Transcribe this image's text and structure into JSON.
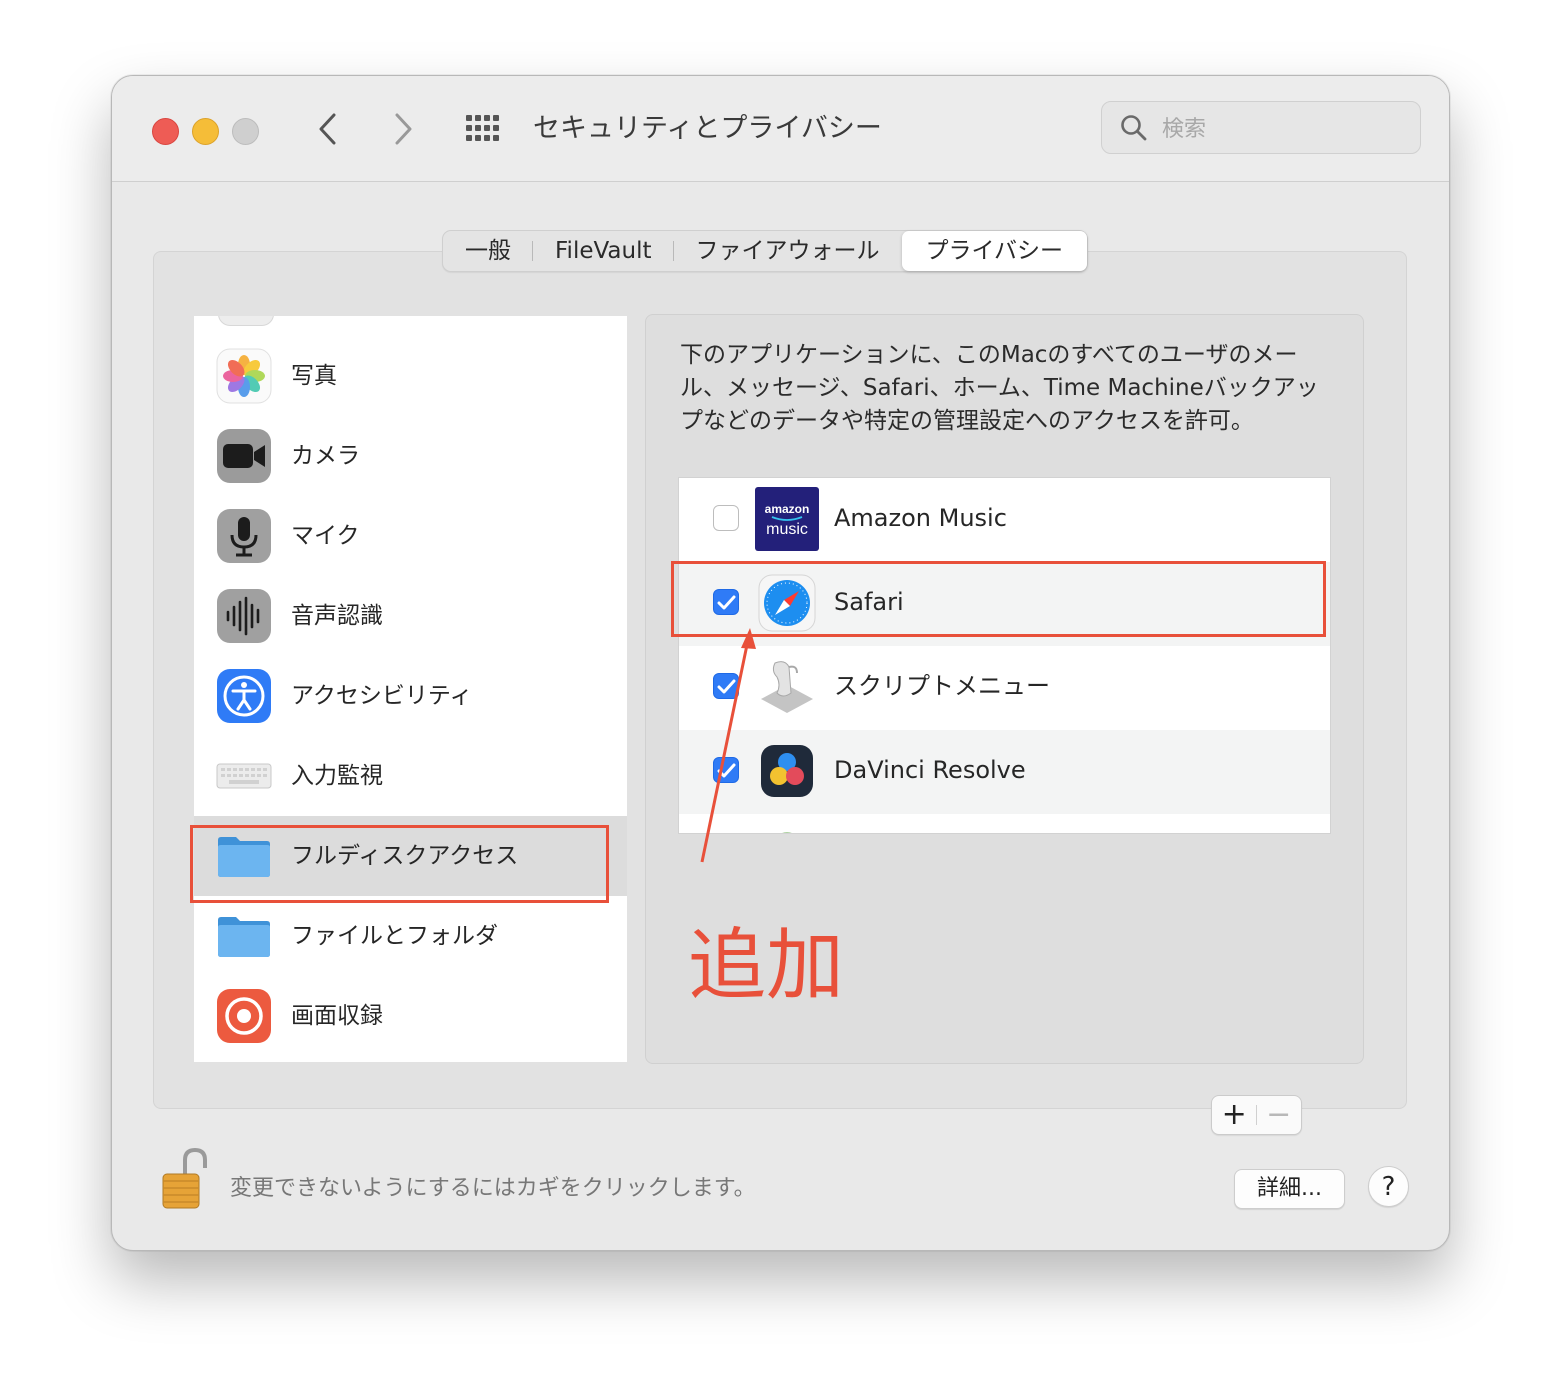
{
  "window": {
    "title": "セキュリティとプライバシー",
    "search_placeholder": "検索"
  },
  "tabs": [
    {
      "label": "一般",
      "active": false
    },
    {
      "label": "FileVault",
      "active": false
    },
    {
      "label": "ファイアウォール",
      "active": false
    },
    {
      "label": "プライバシー",
      "active": true
    }
  ],
  "sidebar": {
    "items": [
      {
        "label": "写真",
        "icon": "photos-icon"
      },
      {
        "label": "カメラ",
        "icon": "camera-icon"
      },
      {
        "label": "マイク",
        "icon": "microphone-icon"
      },
      {
        "label": "音声認識",
        "icon": "speech-recognition-icon"
      },
      {
        "label": "アクセシビリティ",
        "icon": "accessibility-icon"
      },
      {
        "label": "入力監視",
        "icon": "keyboard-icon"
      },
      {
        "label": "フルディスクアクセス",
        "icon": "folder-icon",
        "selected": true
      },
      {
        "label": "ファイルとフォルダ",
        "icon": "folder-icon"
      },
      {
        "label": "画面収録",
        "icon": "screen-recording-icon"
      }
    ]
  },
  "panel": {
    "description": "下のアプリケーションに、このMacのすべてのユーザのメール、メッセージ、Safari、ホーム、Time Machineバックアップなどのデータや特定の管理設定へのアクセスを許可。",
    "apps": [
      {
        "name": "Amazon Music",
        "checked": false,
        "icon": "amazon-music-icon"
      },
      {
        "name": "Safari",
        "checked": true,
        "icon": "safari-icon"
      },
      {
        "name": "スクリプトメニュー",
        "checked": true,
        "icon": "script-menu-icon"
      },
      {
        "name": "DaVinci Resolve",
        "checked": true,
        "icon": "davinci-resolve-icon"
      }
    ],
    "amazon_icon_text_top": "amazon",
    "amazon_icon_text_bottom": "music",
    "add_label": "+",
    "remove_label": "−"
  },
  "annotation": {
    "text": "追加",
    "color": "#e8503a"
  },
  "footer": {
    "lock_text": "変更できないようにするにはカギをクリックします。",
    "details_label": "詳細...",
    "help_label": "?"
  },
  "colors": {
    "accent": "#2f7bf6",
    "annotation": "#e8503a",
    "close": "#ee5c55",
    "minimize": "#f5bd38"
  }
}
